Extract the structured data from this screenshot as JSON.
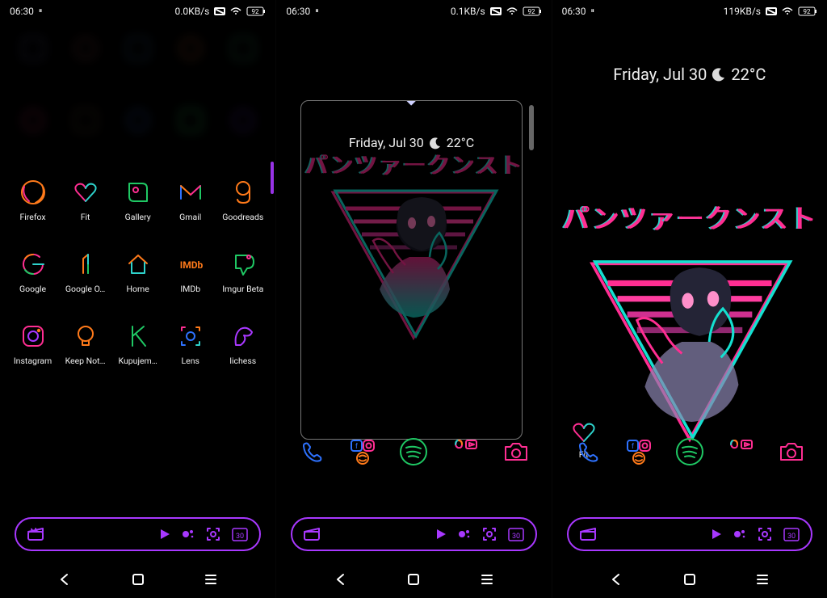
{
  "status": {
    "time": "06:30",
    "indicator": "⏸",
    "net1": "0.0KB/s",
    "net2": "0.1KB/s",
    "net3": "119KB/s",
    "battery": "92"
  },
  "colors": {
    "purple": "#a838ff",
    "magenta": "#ff2e92",
    "cyan": "#2ed3cc",
    "orange": "#ff7a1a",
    "green": "#1fc864",
    "blue": "#2e72ff",
    "pink": "#ff4fb2"
  },
  "panel1": {
    "blur_rows": [
      [
        "",
        "",
        "",
        "",
        ""
      ],
      [
        "",
        "",
        "",
        "",
        ""
      ]
    ],
    "apps": [
      {
        "label": "Firefox",
        "icon": "firefox"
      },
      {
        "label": "Fit",
        "icon": "fit"
      },
      {
        "label": "Gallery",
        "icon": "gallery"
      },
      {
        "label": "Gmail",
        "icon": "gmail"
      },
      {
        "label": "Goodreads",
        "icon": "goodreads"
      },
      {
        "label": "Google",
        "icon": "google"
      },
      {
        "label": "Google O…",
        "icon": "googleone"
      },
      {
        "label": "Home",
        "icon": "home"
      },
      {
        "label": "IMDb",
        "icon": "imdb"
      },
      {
        "label": "Imgur Beta",
        "icon": "imgur"
      },
      {
        "label": "Instagram",
        "icon": "instagram"
      },
      {
        "label": "Keep Not…",
        "icon": "keep"
      },
      {
        "label": "Kupujem…",
        "icon": "kupujem"
      },
      {
        "label": "Lens",
        "icon": "lens"
      },
      {
        "label": "lichess",
        "icon": "lichess"
      }
    ]
  },
  "widget": {
    "day": "Friday, Jul 30",
    "temp": "22°C"
  },
  "wallpaper": {
    "katakana": "パンツァークンスト"
  },
  "panel3": {
    "fit_label": "Fit"
  },
  "dock": {
    "items": [
      "phone",
      "social-folder",
      "spotify",
      "google-folder",
      "camera"
    ]
  },
  "pill": {
    "left": [
      "clapper"
    ],
    "right": [
      "play",
      "assistant",
      "lens-dot",
      "calendar-30"
    ],
    "calendar_day": "30"
  },
  "nav": {
    "back": "‹",
    "home": "□",
    "recent": "≡"
  }
}
